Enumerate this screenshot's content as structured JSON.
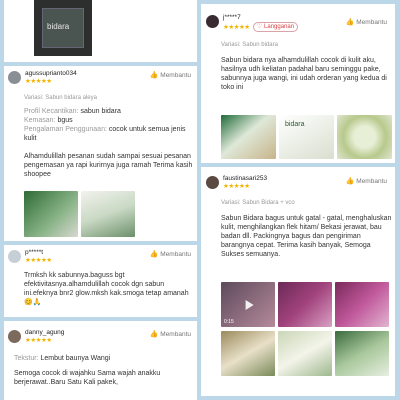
{
  "colors": {
    "background": "#bcd7e7",
    "star": "#f0b400",
    "badge": "#d44"
  },
  "common": {
    "helpful_label": "Membantu",
    "stars": "★★★★★",
    "thumb_icon": "thumbs-up-icon"
  },
  "card_top_photo": {
    "brand_text": "bidara"
  },
  "review1": {
    "username": "agussuprianto034",
    "variant": "Variasi: Sabun bidara aleya",
    "lines": [
      {
        "label": "Profil Kecantikan:",
        "value": "sabun bidara"
      },
      {
        "label": "Kemasan:",
        "value": "bgus"
      },
      {
        "label": "Pengalaman Penggunaan:",
        "value": "cocok untuk semua jenis kulit"
      }
    ],
    "text": "Alhamdulillah pesanan sudah sampai sesuai pesanan pengemasan ya rapi kurirnya juga ramah Terima kasih shoopee"
  },
  "review2": {
    "username": "p*****t",
    "text": "Trmksh kk sabunnya.baguss bgt efektivitasnya.alhamdulillah cocok dgn sabun ini.efeknya bnr2 glow.mksh kak.smoga tetap amanah😊🙏"
  },
  "review3": {
    "username": "danny_agung",
    "lines": [
      {
        "label": "Tekstur:",
        "value": "Lembut baunya Wangi"
      }
    ],
    "text": "Semoga cocok di wajahku Sama wajah anakku berjerawat..Baru Satu Kali pakek,"
  },
  "review4": {
    "username": "j*****7",
    "badge": "Langganan",
    "variant": "Variasi: Sabun bidara",
    "text": "Sabun bidara nya alhamdulillah cocok di kulit aku, hasilnya udh keliatan padahal baru seminggu pake, sabunnya juga wangi, ini udah orderan yang kedua di toko ini",
    "photo_label": "bidara"
  },
  "review5": {
    "username": "faustinasari253",
    "variant": "Variasi: Sabun Bidara + vco",
    "text": "Sabun Bidara bagus untuk gatal - gatal, menghaluskan kulit, menghilangkan flek hitam/ Bekasi jerawat, bau badan dll. Packingnya bagus dan pengiriman barangnya cepat. Terima kasih banyak, Semoga Sukses semuanya.",
    "video_duration": "0:15"
  }
}
